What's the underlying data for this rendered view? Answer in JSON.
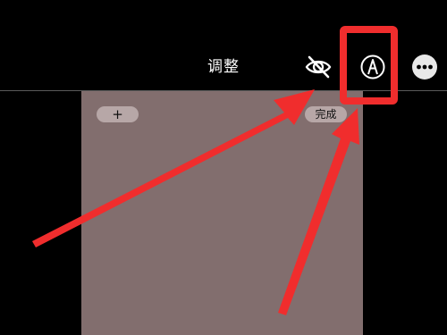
{
  "header": {
    "title": "调整"
  },
  "toolbar": {
    "visibility_icon": "eye-slash-icon",
    "markup_icon": "markup-pen-icon",
    "more_icon": "more-options-icon"
  },
  "canvas": {
    "add_label": "+",
    "done_label": "完成"
  },
  "colors": {
    "annotation_red": "#f02d2d",
    "canvas_background": "#826e6e",
    "pill_background": "#b7a7a7"
  }
}
